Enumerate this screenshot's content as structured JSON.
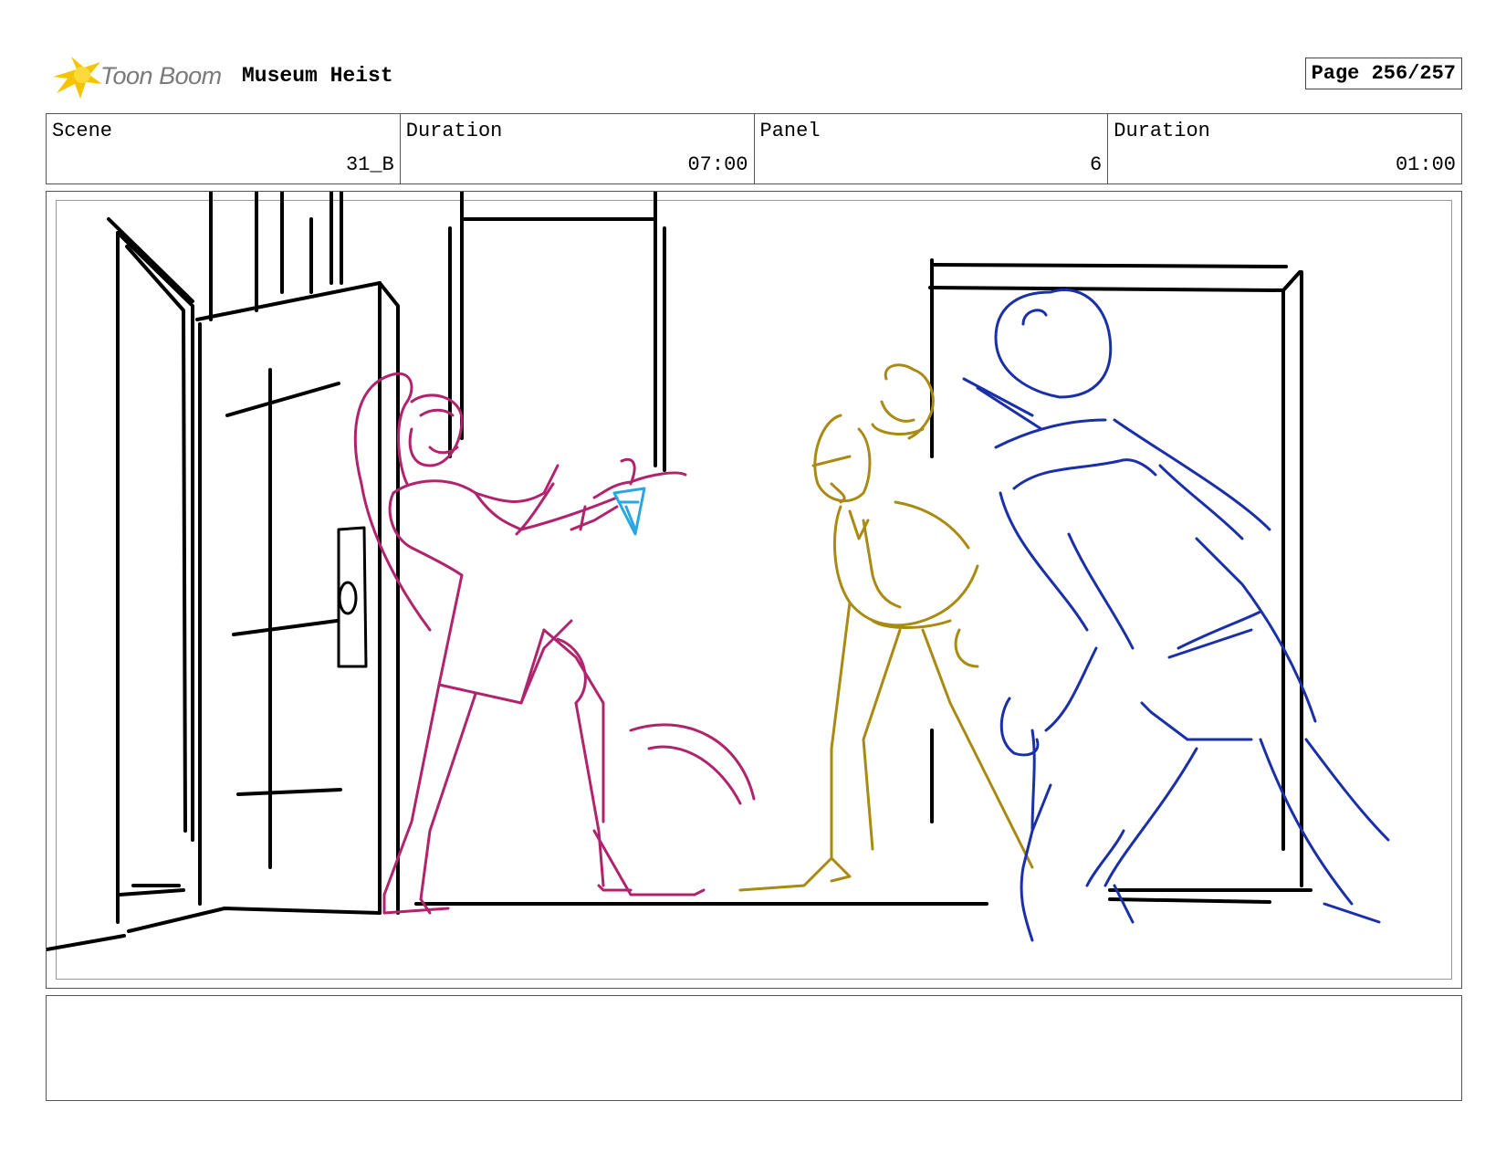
{
  "header": {
    "logo_text": "Toon Boom",
    "project_title": "Museum Heist",
    "page_label": "Page 256/257"
  },
  "info": {
    "scene_label": "Scene",
    "scene_value": "31_B",
    "scene_duration_label": "Duration",
    "scene_duration_value": "07:00",
    "panel_label": "Panel",
    "panel_value": "6",
    "panel_duration_label": "Duration",
    "panel_duration_value": "01:00"
  },
  "notes": {
    "text": ""
  },
  "colors": {
    "logo_yellow": "#f5c400",
    "sketch_black": "#000000",
    "sketch_magenta": "#b0246e",
    "sketch_cyan": "#2aa7e0",
    "sketch_olive": "#a98a12",
    "sketch_blue": "#1a2fa8"
  },
  "icons": {
    "logo": "toon-boom-starburst-icon"
  }
}
